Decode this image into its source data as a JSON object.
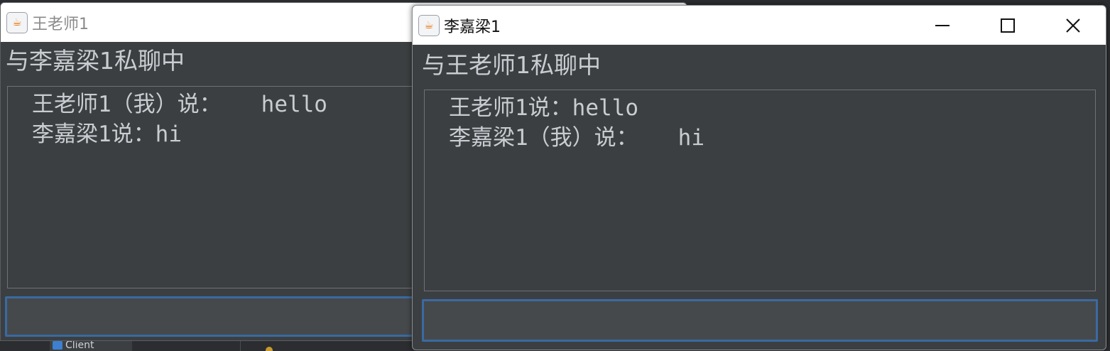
{
  "ide": {
    "tab_label": "Client"
  },
  "back_window": {
    "title": "王老师1",
    "header": "与李嘉梁1私聊中",
    "messages": [
      "王老师1（我）说：   hello",
      "李嘉梁1说：hi"
    ],
    "input_value": ""
  },
  "front_window": {
    "title": "李嘉梁1",
    "header": "与王老师1私聊中",
    "messages": [
      "王老师1说：hello",
      "李嘉梁1（我）说：   hi"
    ],
    "input_value": "",
    "controls": {
      "minimize_icon": "minimize-icon",
      "maximize_icon": "maximize-icon",
      "close_icon": "close-icon"
    }
  },
  "colors": {
    "panel_bg": "#3c3f41",
    "text": "#c9cdd1",
    "input_focus_border": "#3a6aa2",
    "titlebar_bg": "#ffffff"
  }
}
